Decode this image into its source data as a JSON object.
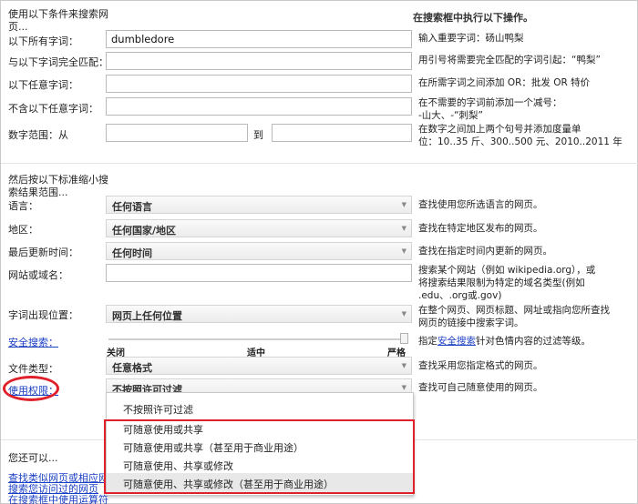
{
  "section1": {
    "heading": "使用以下条件来搜索网页...",
    "right_heading": "在搜索框中执行以下操作。"
  },
  "rows": {
    "all_words": {
      "label": "以下所有字词：",
      "value": "dumbledore",
      "hint": "输入重要字词：砀山鸭梨"
    },
    "exact": {
      "label": "与以下字词完全匹配：",
      "value": "",
      "hint": "用引号将需要完全匹配的字词引起：“鸭梨”"
    },
    "any": {
      "label": "以下任意字词：",
      "value": "",
      "hint": "在所需字词之间添加 OR：批发 OR 特价"
    },
    "none": {
      "label": "不含以下任意字词：",
      "value": "",
      "hint_1": "在不需要的字词前添加一个减号：",
      "hint_2": "-山大、-“刺梨”"
    },
    "range": {
      "label": "数字范围：从",
      "to_label": "到",
      "from_value": "",
      "to_value": "",
      "hint_1": "在数字之间加上两个句号并添加度量单",
      "hint_2": "位：10..35 斤、300..500 元、2010..2011 年"
    }
  },
  "section2": {
    "heading_1": "然后按以下标准缩小搜",
    "heading_2": "索结果范围..."
  },
  "filters": {
    "language": {
      "label": "语言：",
      "value": "任何语言",
      "hint": "查找使用您所选语言的网页。"
    },
    "region": {
      "label": "地区：",
      "value": "任何国家/地区",
      "hint": "查找在特定地区发布的网页。"
    },
    "updated": {
      "label": "最后更新时间：",
      "value": "任何时间",
      "hint": "查找在指定时间内更新的网页。"
    },
    "site": {
      "label": "网站或域名：",
      "value": "",
      "hint_1": "搜索某个网站（例如 wikipedia.org），或",
      "hint_2": "将搜索结果限制为特定的域名类型(例如",
      "hint_3": ".edu、.org或.gov)"
    },
    "occurrence": {
      "label": "字词出现位置：",
      "value": "网页上任何位置",
      "hint_1": "在整个网页、网页标题、网址或指向您所查找",
      "hint_2": "网页的链接中搜索字词。"
    },
    "safesearch": {
      "label": "安全搜索：",
      "level_off": "关闭",
      "level_mid": "适中",
      "level_strict": "严格",
      "hint_pre": "指定",
      "hint_link": "安全搜索",
      "hint_post": "针对色情内容的过滤等级。",
      "level_fraction": 1.0
    },
    "filetype": {
      "label": "文件类型：",
      "value": "任意格式",
      "hint": "查找采用您指定格式的网页。"
    },
    "rights": {
      "label": "使用权限：",
      "value": "不按照许可过滤",
      "hint": "查找可自己随意使用的网页。"
    }
  },
  "rights_dropdown": {
    "options": [
      "不按照许可过滤",
      "可随意使用或共享",
      "可随意使用或共享（甚至用于商业用途）",
      "可随意使用、共享或修改",
      "可随意使用、共享或修改（甚至用于商业用途）"
    ]
  },
  "footer": {
    "heading": "您还可以...",
    "link_1": "查找类似网页或相应网",
    "link_2": "搜索您访问过的网页",
    "link_3": "在搜索框中使用运算符"
  },
  "colors": {
    "annotation": "#e0202a",
    "link": "#1a3fc4"
  }
}
